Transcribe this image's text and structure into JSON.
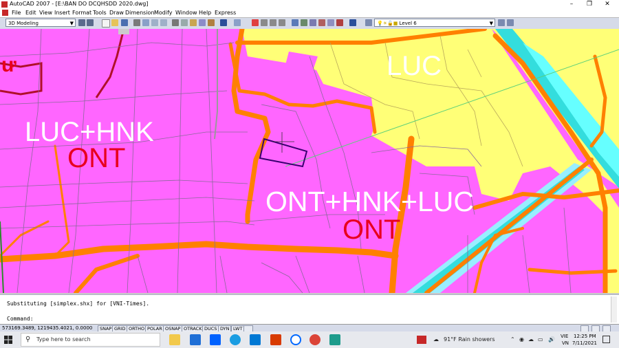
{
  "window": {
    "title": "AutoCAD 2007 - [E:\\BAN DO DCQHSDD 2020.dwg]",
    "controls": [
      "–",
      "❐",
      "✕"
    ]
  },
  "menu": [
    "File",
    "Edit",
    "View",
    "Insert",
    "Format",
    "Tools",
    "Draw",
    "Dimension",
    "Modify",
    "Window",
    "Help",
    "Express"
  ],
  "toolbar": {
    "workspace": "3D Modeling",
    "layer": "Level 6"
  },
  "map_labels": {
    "luc": "LUC",
    "luc_hnk": "LUC+HNK",
    "ont_left": "ONT",
    "ont_hnk_luc": "ONT+HNK+LUC",
    "ont_right": "ONT",
    "partial": "ư"
  },
  "command": {
    "line1": "Substituting [simplex.shx] for [VNI-Times].",
    "line2": "Command:"
  },
  "status": {
    "coords": "573169.3489, 1219435.4021, 0.0000",
    "toggles": [
      "SNAP",
      "GRID",
      "ORTHO",
      "POLAR",
      "OSNAP",
      "OTRACK",
      "DUCS",
      "DYN",
      "LWT"
    ]
  },
  "taskbar": {
    "search_placeholder": "Type here to search",
    "weather": "91°F  Rain showers",
    "lang1": "VIE",
    "lang2": "VN",
    "time": "12:25 PM",
    "date": "7/11/2021"
  },
  "colors": {
    "map_pink": "#ff66ff",
    "map_yellow": "#ffff77",
    "road_orange": "#ff8000",
    "canal_cyan": "#66ffff",
    "label_red": "#e8001e"
  }
}
